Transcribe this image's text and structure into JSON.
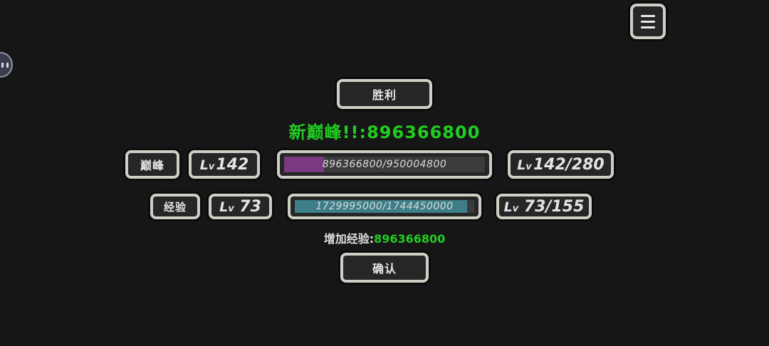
{
  "menu": {
    "icon": "hamburger-menu-icon"
  },
  "side_bubble": {
    "icon": "chat-bubble-icon"
  },
  "victory": {
    "label": "胜利"
  },
  "headline": {
    "prefix": "新巅峰!!:",
    "value": "896366800"
  },
  "peak_row": {
    "label": "巅峰",
    "level_prefix": "L",
    "level_v": "v",
    "level": "142",
    "bar_text": "896366800/950004800",
    "bar_progress": 0.2,
    "bar_color": "#7a3a82",
    "max_prefix": "L",
    "max_v": "v",
    "max_level": "142/280"
  },
  "exp_row": {
    "label": "经验",
    "level_prefix": "L",
    "level_v": "v",
    "level": "73",
    "bar_text": "1729995000/1744450000",
    "bar_progress": 0.96,
    "bar_color": "#3d7e88",
    "max_prefix": "L",
    "max_v": "v",
    "max_level": "73/155"
  },
  "gain": {
    "label": "增加经验:",
    "value": "896366800"
  },
  "confirm": {
    "label": "确认"
  },
  "colors": {
    "background": "#161616",
    "accent_green": "#22cc22",
    "frame_border": "#cfcfc6"
  }
}
